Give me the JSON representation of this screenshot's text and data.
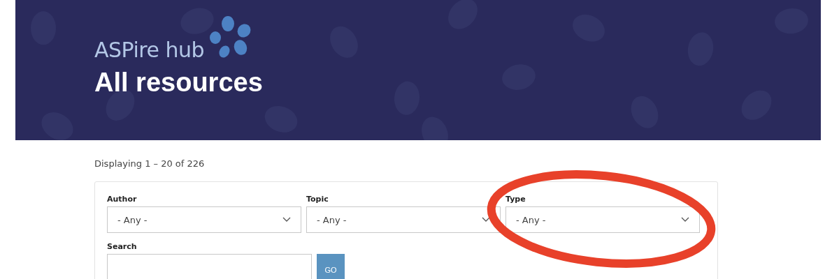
{
  "header": {
    "logo": "ASPire hub",
    "title": "All resources"
  },
  "result_count": "Displaying 1 – 20 of 226",
  "filters": [
    {
      "label": "Author",
      "value": "- Any -"
    },
    {
      "label": "Topic",
      "value": "- Any -"
    },
    {
      "label": "Type",
      "value": "- Any -"
    }
  ],
  "search": {
    "label": "Search",
    "button": "GO"
  },
  "annotation": {
    "kind": "ellipse"
  }
}
